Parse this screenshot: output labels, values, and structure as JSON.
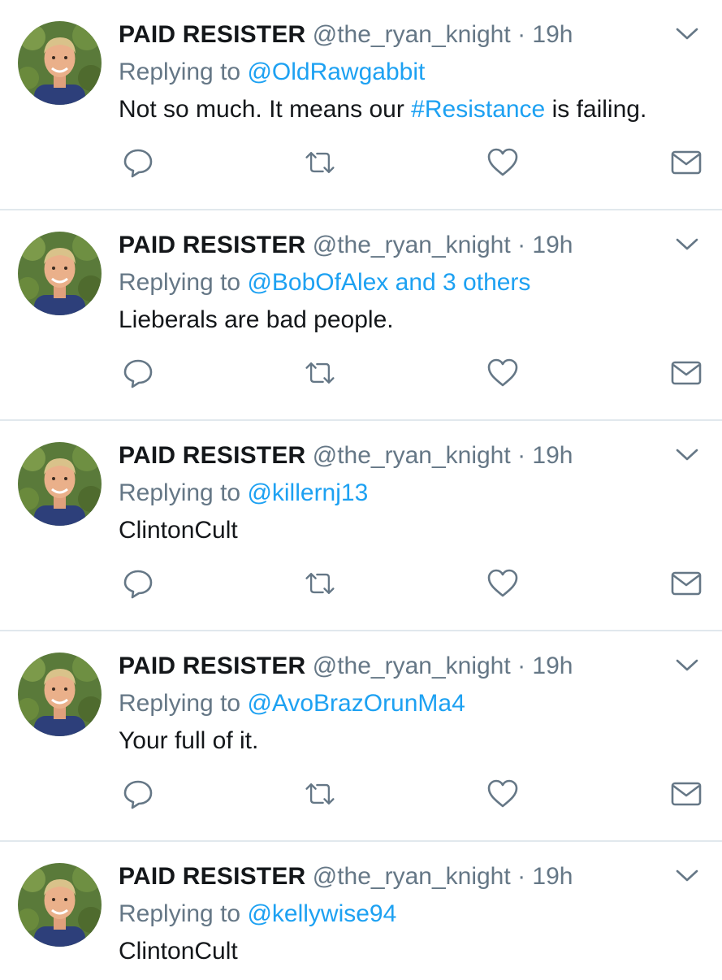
{
  "tweets": [
    {
      "name": "PAID RESISTER",
      "handle": "@the_ryan_knight",
      "separator": "·",
      "time": "19h",
      "reply_prefix": "Replying to",
      "reply_to": "@OldRawgabbit",
      "text_before": "Not so much. It means our ",
      "hashtag": "#Resistance",
      "text_after": " is failing."
    },
    {
      "name": "PAID RESISTER",
      "handle": "@the_ryan_knight",
      "separator": "·",
      "time": "19h",
      "reply_prefix": "Replying to",
      "reply_to": "@BobOfAlex and 3 others",
      "text": "Lieberals are bad people."
    },
    {
      "name": "PAID RESISTER",
      "handle": "@the_ryan_knight",
      "separator": "·",
      "time": "19h",
      "reply_prefix": "Replying to",
      "reply_to": "@killernj13",
      "text": "ClintonCult"
    },
    {
      "name": "PAID RESISTER",
      "handle": "@the_ryan_knight",
      "separator": "·",
      "time": "19h",
      "reply_prefix": "Replying to",
      "reply_to": "@AvoBrazOrunMa4",
      "text": "Your full of it."
    },
    {
      "name": "PAID RESISTER",
      "handle": "@the_ryan_knight",
      "separator": "·",
      "time": "19h",
      "reply_prefix": "Replying to",
      "reply_to": "@kellywise94",
      "text": "ClintonCult"
    }
  ],
  "icons": {
    "caret": "chevron-down-icon",
    "reply": "reply-bubble-icon",
    "retweet": "retweet-icon",
    "like": "heart-icon",
    "dm": "envelope-icon"
  },
  "colors": {
    "name": "#14171a",
    "meta": "#657786",
    "link": "#1da1f2",
    "divider": "#e1e8ed",
    "icon": "#657786"
  }
}
